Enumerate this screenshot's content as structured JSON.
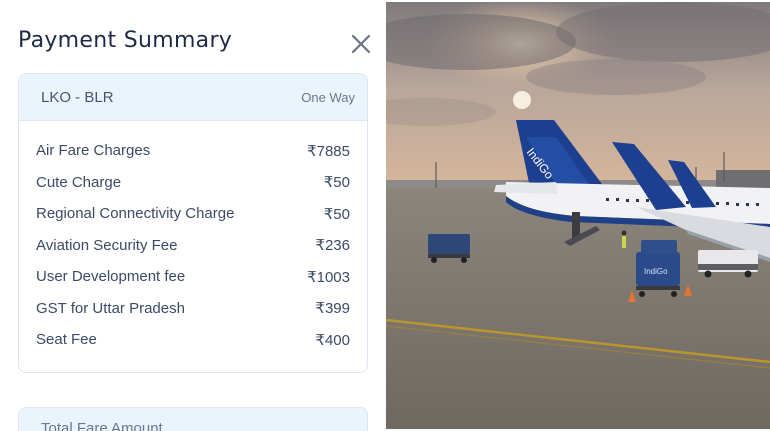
{
  "header": {
    "title": "Payment Summary"
  },
  "trip": {
    "route": "LKO - BLR",
    "type": "One Way"
  },
  "charges": [
    {
      "label": "Air Fare Charges",
      "amount": "₹7885"
    },
    {
      "label": "Cute Charge",
      "amount": "₹50"
    },
    {
      "label": "Regional Connectivity Charge",
      "amount": "₹50"
    },
    {
      "label": "Aviation Security Fee",
      "amount": "₹236"
    },
    {
      "label": "User Development fee",
      "amount": "₹1003"
    },
    {
      "label": "GST for Uttar Pradesh",
      "amount": "₹399"
    },
    {
      "label": "Seat Fee",
      "amount": "₹400"
    }
  ],
  "total": {
    "label": "Total Fare Amount"
  },
  "photo": {
    "tail_text": "IndiGo",
    "cart_text": "IndiGo"
  },
  "icons": {
    "close": "close-icon"
  },
  "colors": {
    "header_bg": "#e9f4fc",
    "tail_blue": "#1c3f8f",
    "card_border": "#dfe6f0"
  }
}
